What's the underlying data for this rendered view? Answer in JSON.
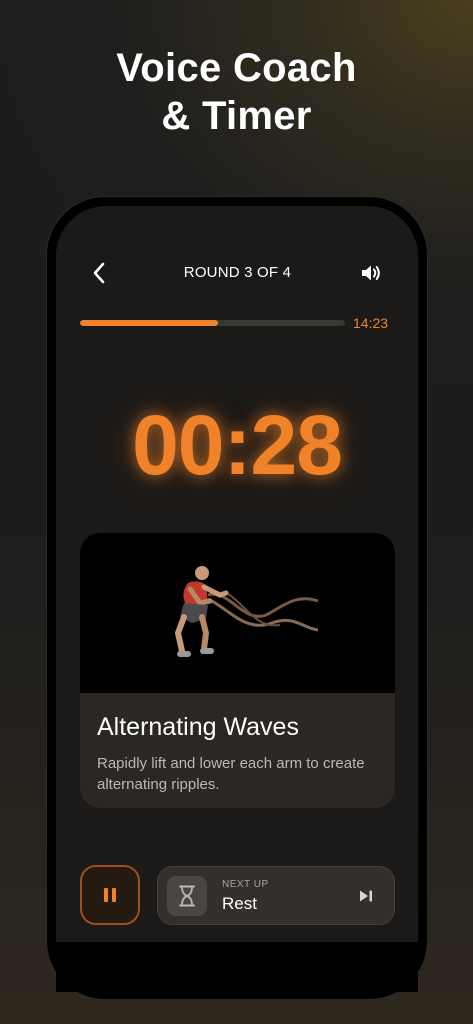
{
  "headline": {
    "line1": "Voice Coach",
    "line2": "& Timer"
  },
  "header": {
    "round_label": "ROUND 3 OF 4"
  },
  "progress": {
    "fraction": 0.52,
    "total_time": "14:23"
  },
  "timer": {
    "remaining": "00:28"
  },
  "exercise": {
    "title": "Alternating Waves",
    "description": "Rapidly lift and lower each arm to create alternating ripples."
  },
  "next_up": {
    "caption": "NEXT UP",
    "name": "Rest"
  },
  "icons": {
    "back": "chevron-left-icon",
    "sound": "speaker-icon",
    "pause": "pause-icon",
    "hourglass": "hourglass-icon",
    "skip": "skip-next-icon"
  },
  "colors": {
    "accent": "#f0832a",
    "screen_bg": "#1c1a18",
    "card_bg": "#2a2724"
  }
}
